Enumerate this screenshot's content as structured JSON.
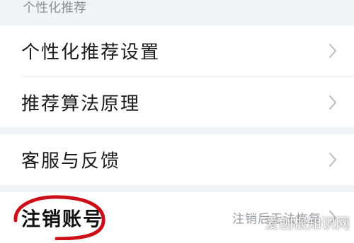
{
  "section": {
    "header": "个性化推荐"
  },
  "group1": {
    "items": [
      {
        "label": "个性化推荐设置"
      },
      {
        "label": "推荐算法原理"
      }
    ]
  },
  "group2": {
    "items": [
      {
        "label": "客服与反馈"
      }
    ]
  },
  "group3": {
    "items": [
      {
        "label": "注销账号",
        "value": "注销后无法恢复"
      }
    ]
  },
  "watermark": "爱刨根知识网",
  "colors": {
    "page_background": "#f2f3f6",
    "card_background": "#ffffff",
    "annotation": "#cc0f18"
  },
  "icons": {
    "row_arrow": "chevron-right-icon"
  }
}
